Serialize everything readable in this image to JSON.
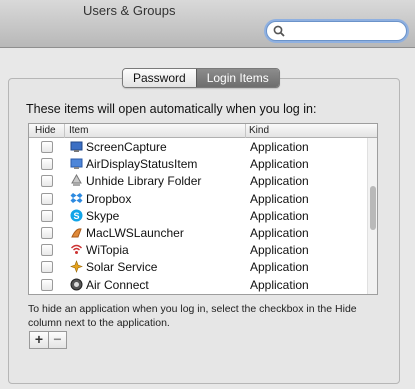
{
  "window": {
    "title": "Users & Groups"
  },
  "search": {
    "value": "",
    "placeholder": ""
  },
  "tabs": [
    {
      "label": "Password",
      "active": false
    },
    {
      "label": "Login Items",
      "active": true
    }
  ],
  "login_items": {
    "intro": "These items will open automatically when you log in:",
    "columns": {
      "hide": "Hide",
      "item": "Item",
      "kind": "Kind"
    },
    "rows": [
      {
        "name": "ScreenCapture",
        "kind": "Application",
        "hidden": false,
        "icon": "screen-capture-icon"
      },
      {
        "name": "AirDisplayStatusItem",
        "kind": "Application",
        "hidden": false,
        "icon": "air-display-icon"
      },
      {
        "name": "Unhide Library Folder",
        "kind": "Application",
        "hidden": false,
        "icon": "library-folder-icon"
      },
      {
        "name": "Dropbox",
        "kind": "Application",
        "hidden": false,
        "icon": "dropbox-icon"
      },
      {
        "name": "Skype",
        "kind": "Application",
        "hidden": false,
        "icon": "skype-icon"
      },
      {
        "name": "MacLWSLauncher",
        "kind": "Application",
        "hidden": false,
        "icon": "lws-launcher-icon"
      },
      {
        "name": "WiTopia",
        "kind": "Application",
        "hidden": false,
        "icon": "witopia-icon"
      },
      {
        "name": "Solar Service",
        "kind": "Application",
        "hidden": false,
        "icon": "solar-service-icon"
      },
      {
        "name": "Air Connect",
        "kind": "Application",
        "hidden": false,
        "icon": "air-connect-icon"
      }
    ],
    "help_text": "To hide an application when you log in, select the checkbox in the Hide column next to the application.",
    "add_label": "+",
    "remove_label": "−"
  },
  "colors": {
    "accent": "#6b93c9",
    "selected_tab": "#7d7d7d"
  }
}
